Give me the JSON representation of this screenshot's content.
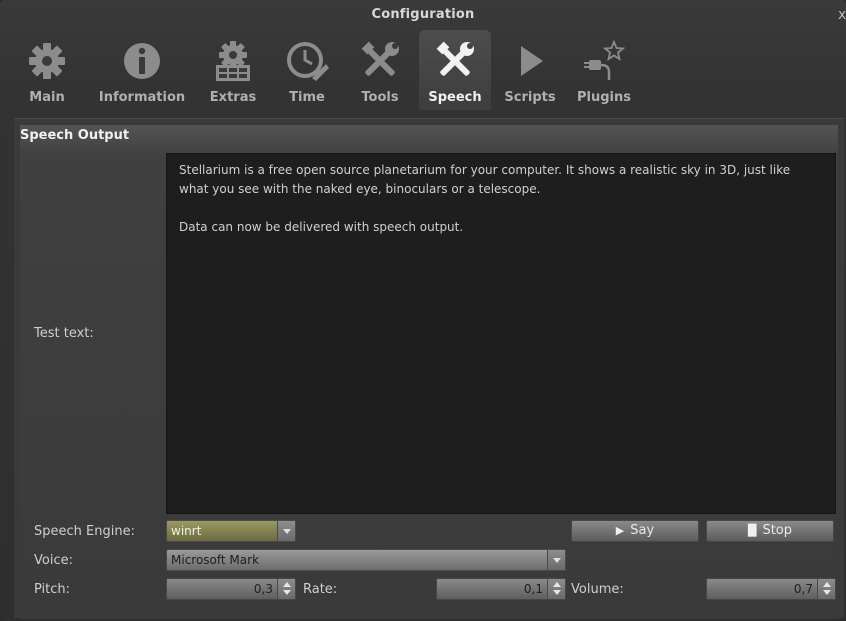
{
  "window": {
    "title": "Configuration",
    "close_glyph": "x"
  },
  "tabs": [
    {
      "label": "Main",
      "icon": "gear-icon"
    },
    {
      "label": "Information",
      "icon": "info-icon"
    },
    {
      "label": "Extras",
      "icon": "gear-grid-icon"
    },
    {
      "label": "Time",
      "icon": "clock-icon"
    },
    {
      "label": "Tools",
      "icon": "tools-icon"
    },
    {
      "label": "Speech",
      "icon": "tools-icon",
      "active": true
    },
    {
      "label": "Scripts",
      "icon": "play-icon"
    },
    {
      "label": "Plugins",
      "icon": "plugin-star-icon"
    }
  ],
  "speech": {
    "section_title": "Speech Output",
    "test_text_label": "Test text:",
    "test_text_para1": "Stellarium is a free open source planetarium for your computer. It shows a realistic sky in 3D, just like what you see with the naked eye, binoculars or a telescope.",
    "test_text_para2": "Data can now be delivered with speech output.",
    "engine_label": "Speech Engine:",
    "engine_value": "winrt",
    "voice_label": "Voice:",
    "voice_value": "Microsoft Mark",
    "pitch_label": "Pitch:",
    "pitch_value": "0,3",
    "rate_label": "Rate:",
    "rate_value": "0,1",
    "volume_label": "Volume:",
    "volume_value": "0,7",
    "say_label": "Say",
    "stop_label": "Stop"
  },
  "colors": {
    "accent_engine": "#8a8a55",
    "text_bg": "#1e1e1e"
  }
}
